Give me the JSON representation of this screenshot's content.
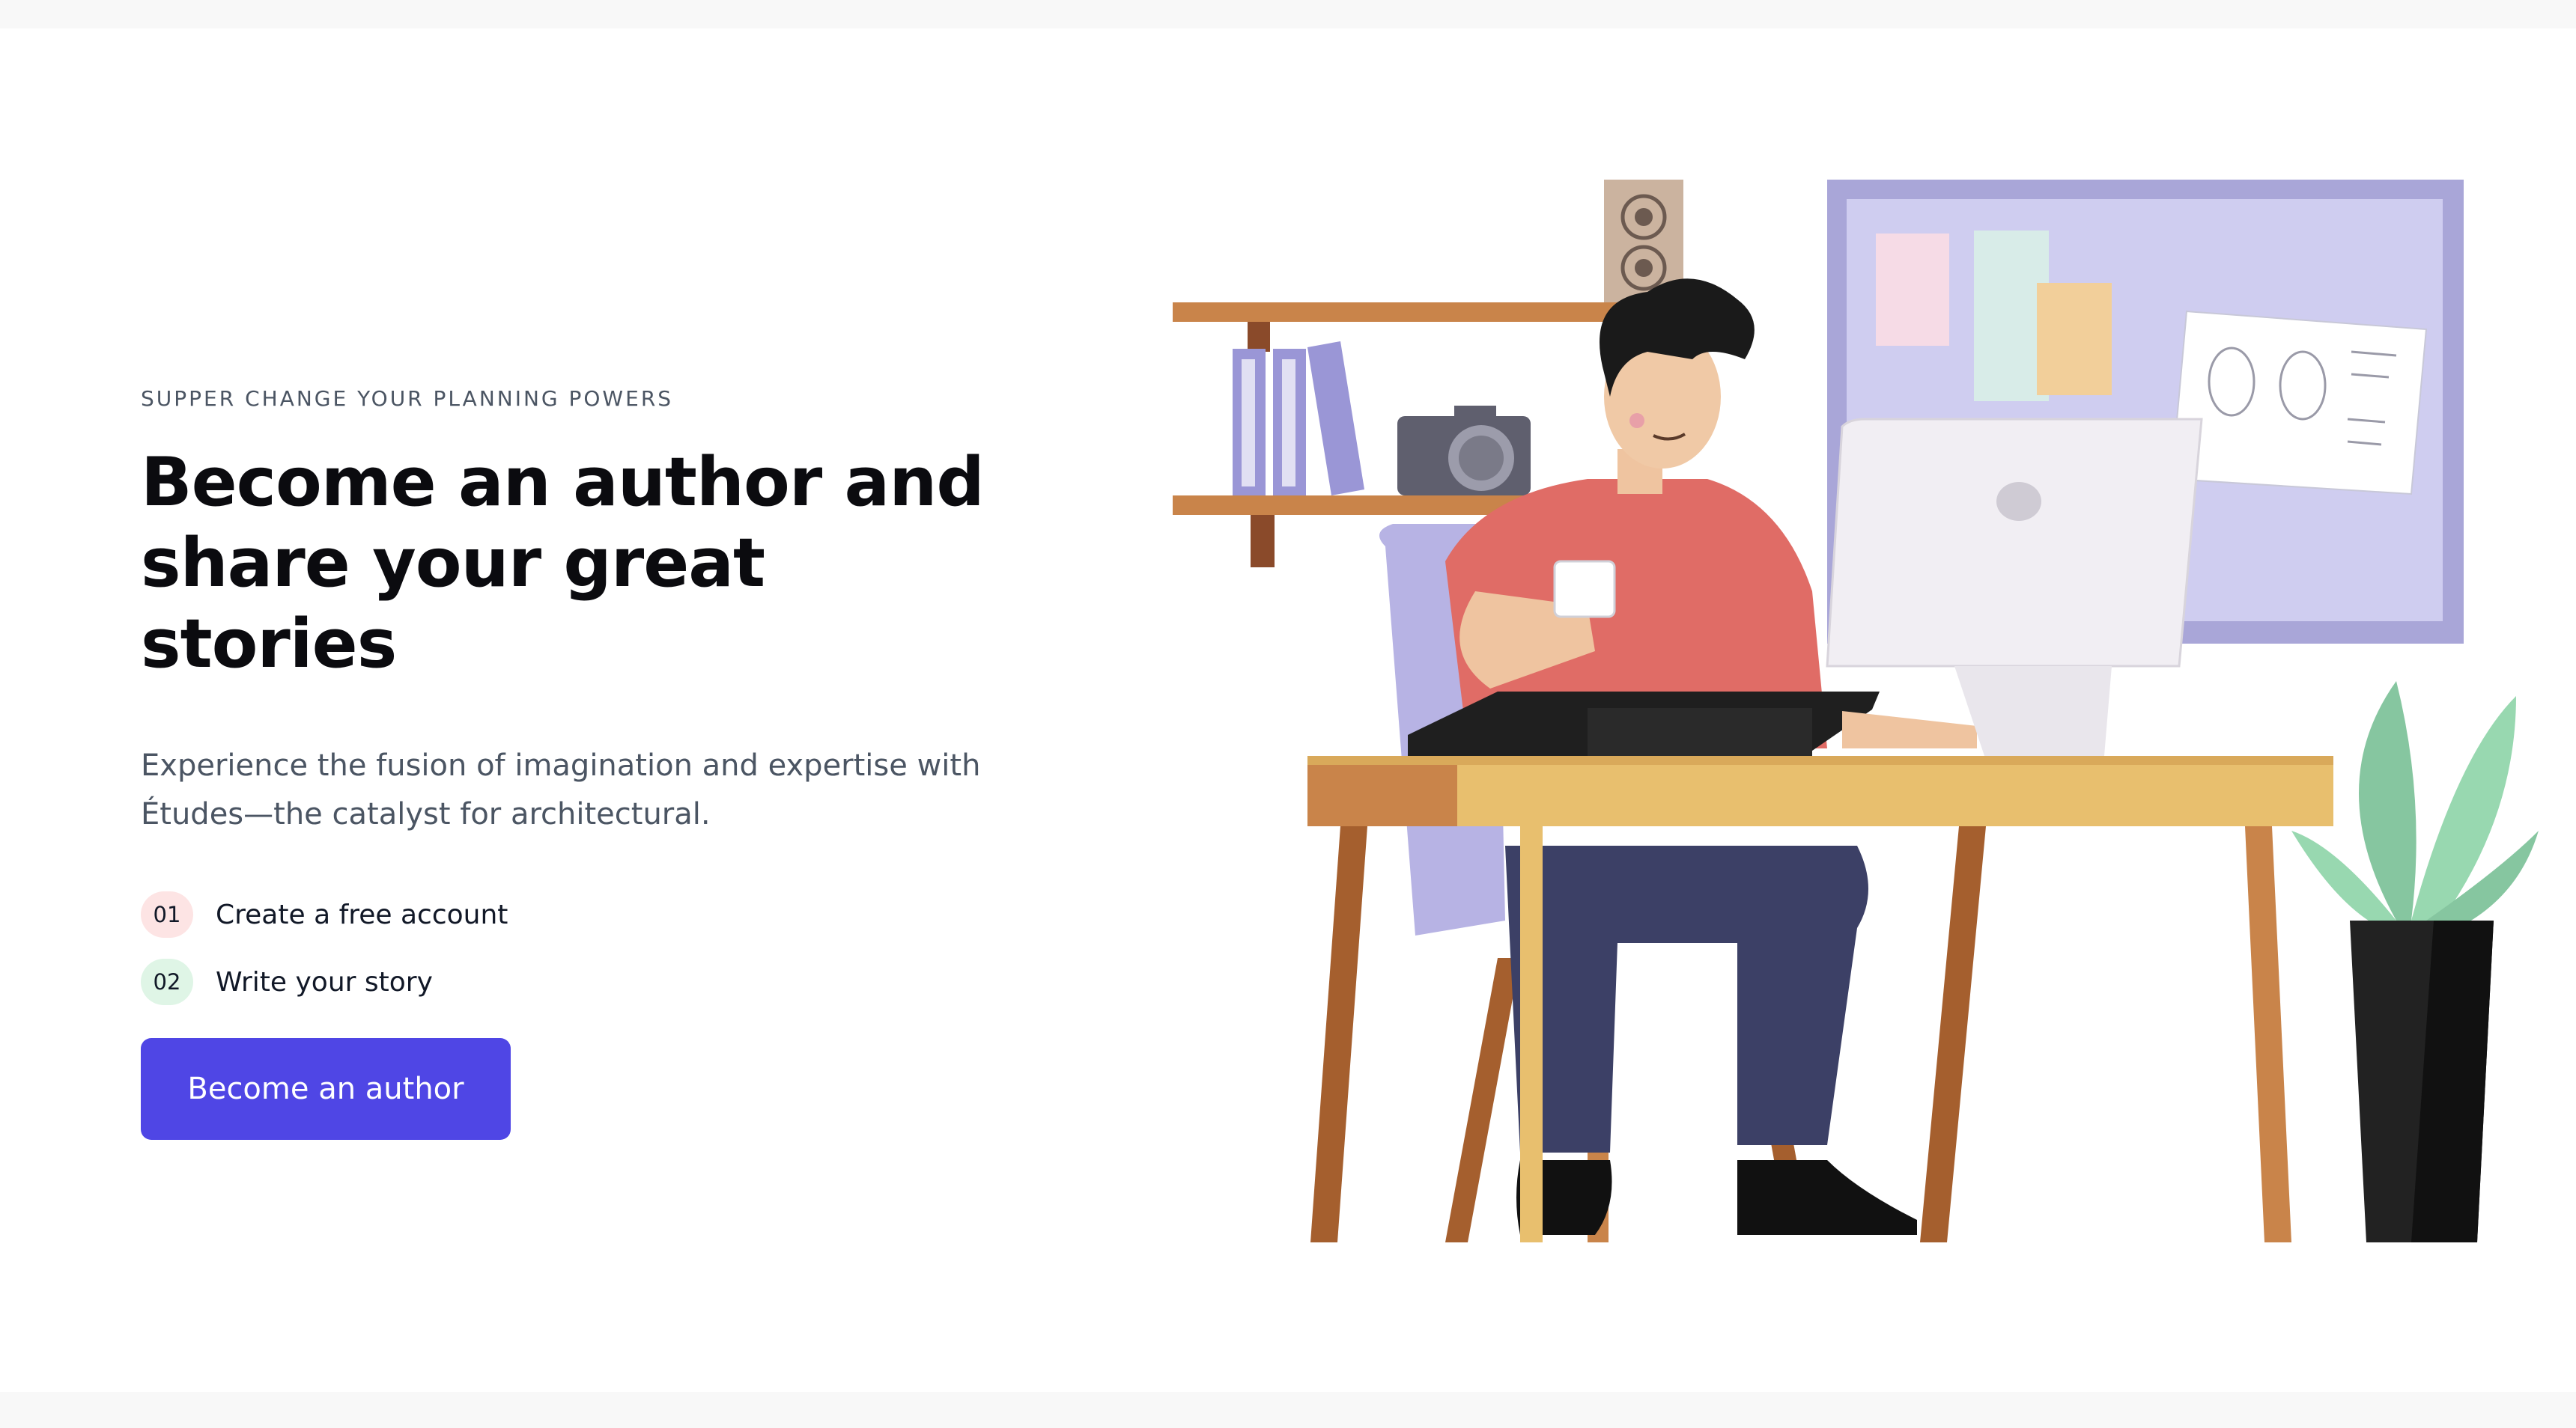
{
  "hero": {
    "eyebrow": "SUPPER CHANGE YOUR PLANNING POWERS",
    "headline_line1": "Become an author and",
    "headline_line2": "share your great stories",
    "description_line1": "Experience the fusion of imagination and expertise with",
    "description_line2": "Études—the catalyst for architectural.",
    "steps": [
      {
        "number": "01",
        "label": "Create a free account"
      },
      {
        "number": "02",
        "label": "Write your story"
      }
    ],
    "cta_label": "Become an author"
  },
  "colors": {
    "accent": "#4f46e5",
    "step1_bg": "#fde4e4",
    "step2_bg": "#dff5e6",
    "heading": "#0b0b0f",
    "muted": "#4b5563"
  },
  "illustration": {
    "name": "man-working-at-desk-illustration"
  }
}
